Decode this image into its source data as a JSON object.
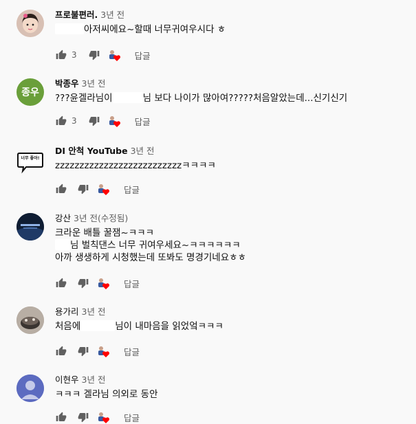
{
  "comments": [
    {
      "author": "프로불편러.",
      "time": "3년 전",
      "text1_after": "아저씨에요~할때 너무귀여우시다 ㅎ",
      "likes": "3",
      "reply_label": "답글"
    },
    {
      "author": "박종우",
      "avatar_text": "종우",
      "avatar_color": "#6a9f3a",
      "time": "3년 전",
      "text_before": "???윤겔라님이",
      "text_after": "님 보다 나이가 많아여?????처음알았는데...신기신기",
      "likes": "3",
      "reply_label": "답글"
    },
    {
      "author": "DI 안척 YouTube",
      "avatar_text": "너무 좋아!",
      "time": "3년 전",
      "text": "zzzzzzzzzzzzzzzzzzzzzzzzzzㅋㅋㅋㅋ",
      "reply_label": "답글"
    },
    {
      "author": "강산",
      "time": "3년 전(수정됨)",
      "line1": "크라운 배틀 꿀잼~ㅋㅋㅋ",
      "line2_after": "님 벌칙댄스 너무 귀여우세요~ㅋㅋㅋㅋㅋㅋ",
      "line3": "아까 생생하게 시청했는데 또봐도 명경기네요ㅎㅎ",
      "reply_label": "답글"
    },
    {
      "author": "용가리",
      "time": "3년 전",
      "text_before": "처음에",
      "text_after": "님이 내마음을 읽었엌ㅋㅋㅋ",
      "reply_label": "답글"
    },
    {
      "author": "이현우",
      "avatar_color": "#5c6bc0",
      "time": "3년 전",
      "text": "ㅋㅋㅋ 겔라님 의외로 동안",
      "reply_label": "답글"
    }
  ],
  "colors": {
    "heart": "#ff0000",
    "meta": "#606060",
    "background": "#f9f9f9"
  },
  "icons": [
    "thumb-up-icon",
    "thumb-down-icon",
    "creator-heart-icon"
  ]
}
